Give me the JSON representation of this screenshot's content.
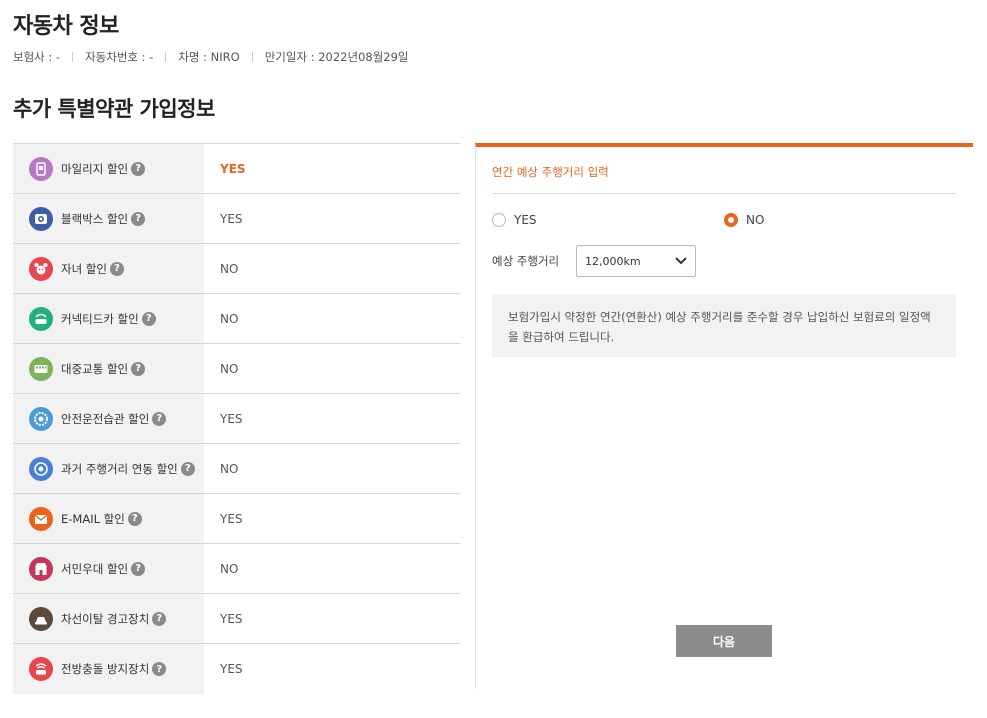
{
  "page": {
    "title": "자동차 정보",
    "section_title": "추가 특별약관 가입정보"
  },
  "info": {
    "insurer": "보험사 : -",
    "car_number": "자동차번호 : -",
    "car_name": "차명 : NIRO",
    "expiry": "만기일자 : 2022년08월29일"
  },
  "help_glyph": "?",
  "discounts": [
    {
      "label": "마일리지 할인",
      "value": "YES",
      "icon": "mileage-icon",
      "color": "#b57ac4",
      "active": true
    },
    {
      "label": "블랙박스 할인",
      "value": "YES",
      "icon": "dashcam-icon",
      "color": "#3e5fa8",
      "active": false
    },
    {
      "label": "자녀 할인",
      "value": "NO",
      "icon": "child-icon",
      "color": "#e8474f",
      "active": false
    },
    {
      "label": "커넥티드카 할인",
      "value": "NO",
      "icon": "connected-car-icon",
      "color": "#22b07d",
      "active": false
    },
    {
      "label": "대중교통 할인",
      "value": "NO",
      "icon": "bus-icon",
      "color": "#7fb25a",
      "active": false
    },
    {
      "label": "안전운전습관 할인",
      "value": "YES",
      "icon": "safe-driving-icon",
      "color": "#4d9bd6",
      "active": false
    },
    {
      "label": "과거 주행거리 연동 할인",
      "value": "NO",
      "icon": "odometer-icon",
      "color": "#4a7fd8",
      "active": false
    },
    {
      "label": "E-MAIL 할인",
      "value": "YES",
      "icon": "email-icon",
      "color": "#e8641b",
      "active": false
    },
    {
      "label": "서민우대 할인",
      "value": "NO",
      "icon": "shop-icon",
      "color": "#c2375a",
      "active": false
    },
    {
      "label": "차선이탈 경고장치",
      "value": "YES",
      "icon": "lane-departure-icon",
      "color": "#5b4a3c",
      "active": false
    },
    {
      "label": "전방충돌 방지장치",
      "value": "YES",
      "icon": "collision-warning-icon",
      "color": "#e8474f",
      "active": false
    }
  ],
  "panel": {
    "title": "연간 예상 주행거리 입력",
    "yes_label": "YES",
    "no_label": "NO",
    "selected": "NO",
    "distance_label": "예상 주행거리",
    "distance_value": "12,000km",
    "notice": "보험가입시 약정한 연간(연환산) 예상 주행거리를 준수할 경우 납입하신 보험료의 일정액을 환급하여 드립니다.",
    "next_label": "다음"
  }
}
